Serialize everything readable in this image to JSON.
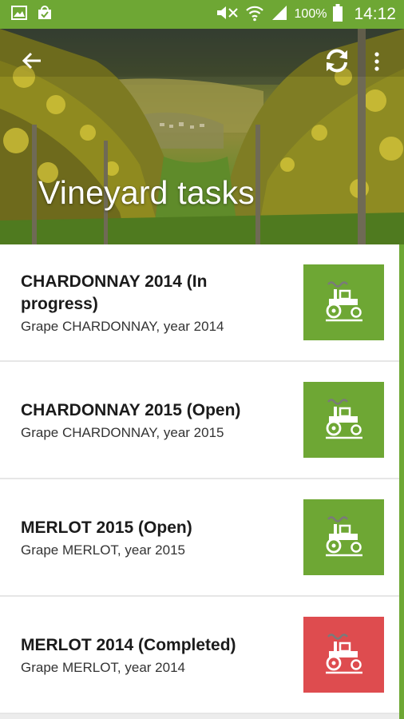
{
  "status_bar": {
    "battery_text": "100%",
    "time": "14:12"
  },
  "header": {
    "title": "Vineyard tasks"
  },
  "tasks": [
    {
      "title": "CHARDONNAY 2014 (In progress)",
      "subtitle": "Grape CHARDONNAY, year 2014",
      "status_color": "#6ea734",
      "icon": "tractor-icon"
    },
    {
      "title": "CHARDONNAY 2015 (Open)",
      "subtitle": "Grape CHARDONNAY, year 2015",
      "status_color": "#6ea734",
      "icon": "tractor-icon"
    },
    {
      "title": "MERLOT 2015 (Open)",
      "subtitle": "Grape MERLOT, year 2015",
      "status_color": "#6ea734",
      "icon": "tractor-icon"
    },
    {
      "title": "MERLOT 2014 (Completed)",
      "subtitle": "Grape MERLOT, year 2014",
      "status_color": "#de4c4f",
      "icon": "tractor-icon"
    }
  ],
  "colors": {
    "accent": "#6ea734",
    "completed": "#de4c4f"
  }
}
